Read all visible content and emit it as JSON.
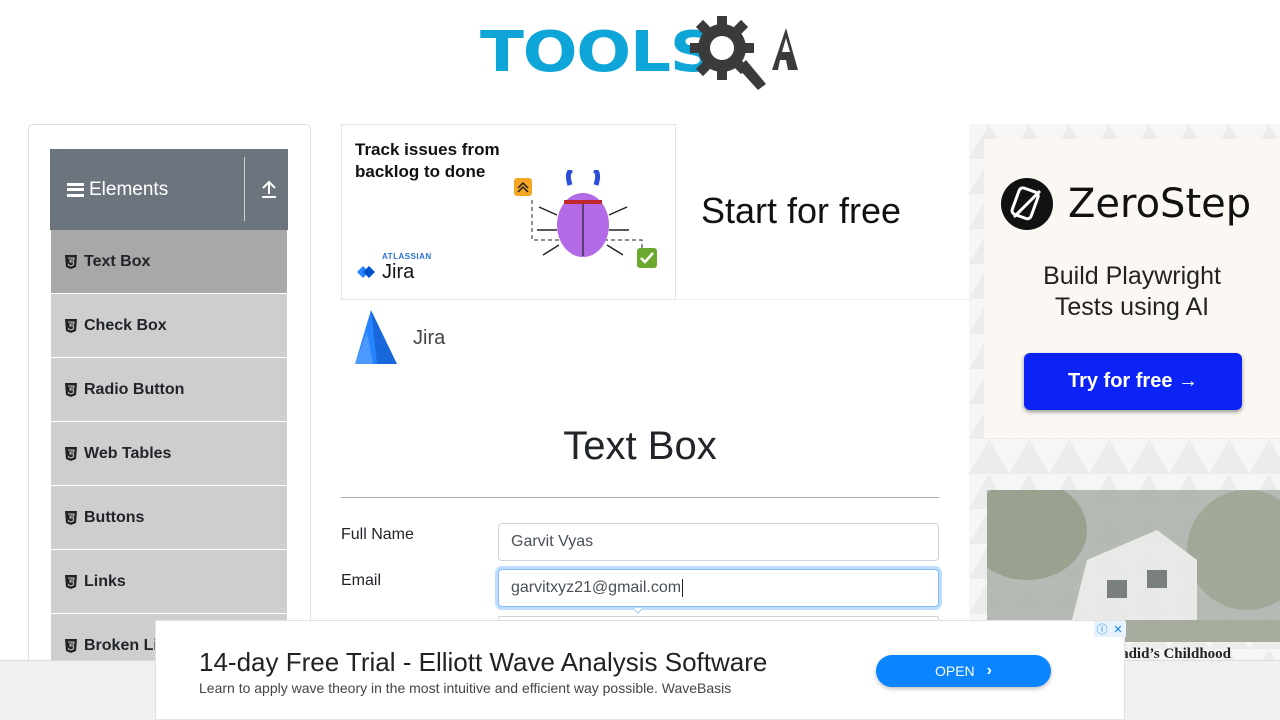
{
  "header": {
    "logo_text": "TOOLS",
    "logo_suffix": "QA"
  },
  "sidebar": {
    "group_title": "Elements",
    "items": [
      {
        "label": "Text Box",
        "active": true
      },
      {
        "label": "Check Box"
      },
      {
        "label": "Radio Button"
      },
      {
        "label": "Web Tables"
      },
      {
        "label": "Buttons"
      },
      {
        "label": "Links"
      },
      {
        "label": "Broken Links - Images"
      }
    ]
  },
  "ad_top": {
    "headline": "Track issues from backlog to done",
    "brand_small": "ATLASSIAN",
    "product_small": "Jira",
    "cta": "Start for free",
    "advertiser": "Jira"
  },
  "form": {
    "title": "Text Box",
    "full_name_label": "Full Name",
    "full_name_value": "Garvit Vyas",
    "email_label": "Email",
    "email_value": "garvitxyz21@gmail.com"
  },
  "ad_right": {
    "brand": "ZeroStep",
    "tagline": "Build Playwright Tests using AI",
    "button": "Try for free →",
    "caption": "la Hadid’s Childhood"
  },
  "ad_bottom": {
    "headline": "14-day Free Trial - Elliott Wave Analysis Software",
    "subtext": "Learn to apply wave theory in the most intuitive and efficient way possible. WaveBasis",
    "button": "OPEN"
  },
  "colors": {
    "accent": "#0ea5d8",
    "sidebar_header": "#6c757d",
    "menu_item": "#cecece",
    "menu_active": "#a8a8a8",
    "zerostep_button": "#0b24f5",
    "open_button": "#0a84ff"
  }
}
